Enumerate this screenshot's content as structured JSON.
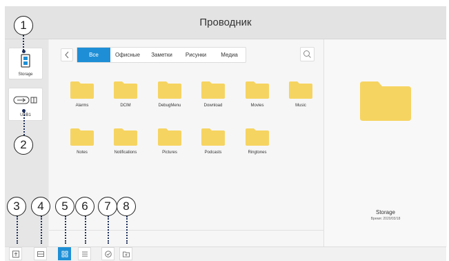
{
  "window": {
    "title": "Проводник"
  },
  "sidebar": {
    "drives": [
      {
        "label": "Storage",
        "icon": "sd-card-icon"
      },
      {
        "label": "USB1",
        "icon": "usb-drive-icon"
      }
    ]
  },
  "filter_tabs": [
    {
      "label": "Все",
      "active": true
    },
    {
      "label": "Офисные",
      "active": false
    },
    {
      "label": "Заметки",
      "active": false
    },
    {
      "label": "Рисунки",
      "active": false
    },
    {
      "label": "Медиа",
      "active": false
    }
  ],
  "folders": [
    {
      "name": "Alarms"
    },
    {
      "name": "DCIM"
    },
    {
      "name": "DebugMenu"
    },
    {
      "name": "Download"
    },
    {
      "name": "Movies"
    },
    {
      "name": "Music"
    },
    {
      "name": "Notes"
    },
    {
      "name": "Notifications"
    },
    {
      "name": "Pictures"
    },
    {
      "name": "Podcasts"
    },
    {
      "name": "Ringtones"
    }
  ],
  "details": {
    "name": "Storage",
    "time": "Время: 2020/03/18"
  },
  "callouts": [
    "1",
    "2",
    "3",
    "4",
    "5",
    "6",
    "7",
    "8"
  ],
  "colors": {
    "accent": "#1e8fd6",
    "folder": "#f6d461",
    "annotation": "#1b2d5a"
  }
}
